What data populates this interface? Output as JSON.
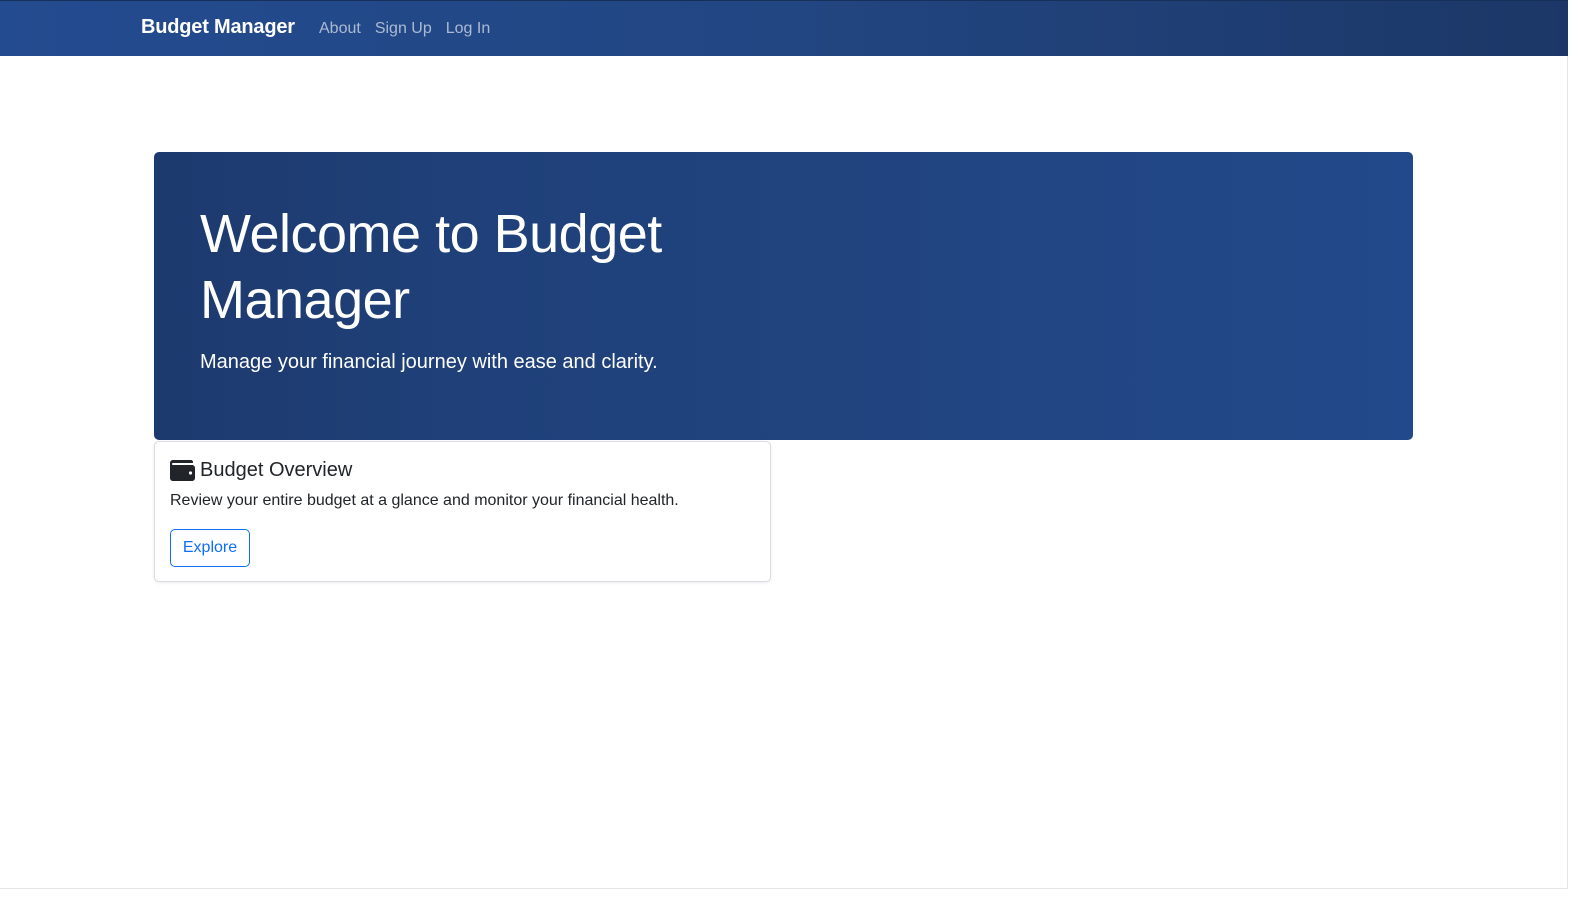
{
  "navbar": {
    "brand": "Budget Manager",
    "links": [
      {
        "label": "About"
      },
      {
        "label": "Sign Up"
      },
      {
        "label": "Log In"
      }
    ]
  },
  "hero": {
    "title": "Welcome to Budget Manager",
    "lead": "Manage your financial journey with ease and clarity."
  },
  "card": {
    "icon": "wallet-icon",
    "title": "Budget Overview",
    "text": "Review your entire budget at a glance and monitor your financial health.",
    "button_label": "Explore"
  },
  "colors": {
    "navbar_bg": "#224682",
    "hero_bg": "#1f4079",
    "accent": "#0d6efd"
  }
}
